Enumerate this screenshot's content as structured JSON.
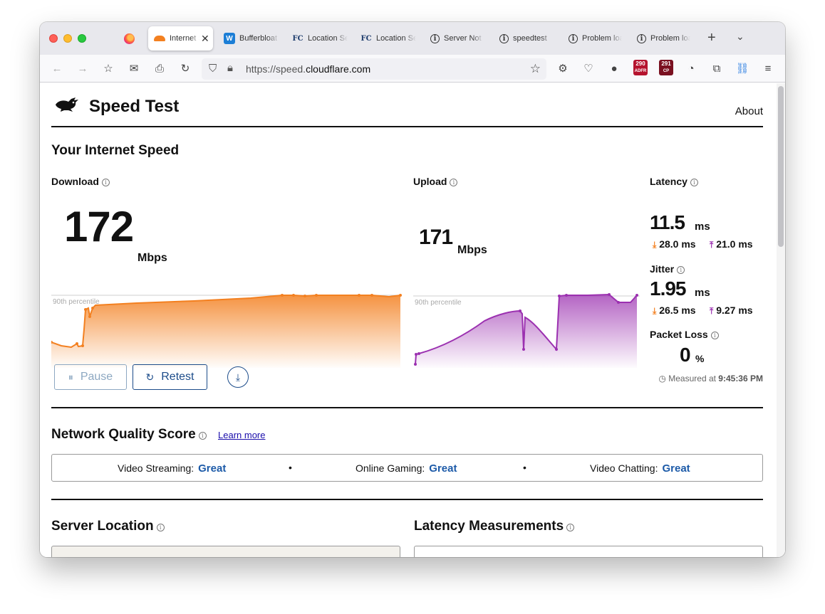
{
  "browser": {
    "tabs": [
      {
        "label": "Internet Speed Test",
        "icon": "cloudflare-icon",
        "active": true
      },
      {
        "label": "Bufferbloat",
        "icon": "waveform-w-icon"
      },
      {
        "label": "Location Services",
        "icon": "fc-icon"
      },
      {
        "label": "Location Services",
        "icon": "fc-icon"
      },
      {
        "label": "Server Not Found",
        "icon": "info-icon"
      },
      {
        "label": "speedtest",
        "icon": "info-icon"
      },
      {
        "label": "Problem loading page",
        "icon": "info-icon"
      },
      {
        "label": "Problem loading page",
        "icon": "info-icon"
      }
    ],
    "url_prefix": "https://speed.",
    "url_domain": "cloudflare.com",
    "badge1": "290",
    "badge1_sub": "ADFR",
    "badge2": "291",
    "badge2_sub": "CP"
  },
  "site": {
    "title": "Speed Test",
    "about": "About"
  },
  "speed": {
    "heading": "Your Internet Speed",
    "download_label": "Download",
    "download_value": "172",
    "download_unit": "Mbps",
    "upload_label": "Upload",
    "upload_value": "171",
    "upload_unit": "Mbps",
    "percentile_label": "90th percentile",
    "latency_label": "Latency",
    "latency_value": "11.5",
    "latency_unit": "ms",
    "latency_down": "28.0 ms",
    "latency_up": "21.0 ms",
    "jitter_label": "Jitter",
    "jitter_value": "1.95",
    "jitter_unit": "ms",
    "jitter_down": "26.5 ms",
    "jitter_up": "9.27 ms",
    "packet_loss_label": "Packet Loss",
    "packet_loss_value": "0",
    "packet_loss_unit": "%"
  },
  "controls": {
    "pause_label": "Pause",
    "retest_label": "Retest",
    "measured_prefix": "Measured at",
    "measured_time": "9:45:36 PM"
  },
  "nqs": {
    "heading": "Network Quality Score",
    "learn_more": "Learn more",
    "items": [
      {
        "label": "Video Streaming:",
        "value": "Great"
      },
      {
        "label": "Online Gaming:",
        "value": "Great"
      },
      {
        "label": "Video Chatting:",
        "value": "Great"
      }
    ]
  },
  "lower": {
    "server_location": "Server Location",
    "latency_measurements": "Latency Measurements"
  },
  "colors": {
    "download": "#f38020",
    "upload": "#9b30b0",
    "link_blue": "#1c5aa8"
  }
}
